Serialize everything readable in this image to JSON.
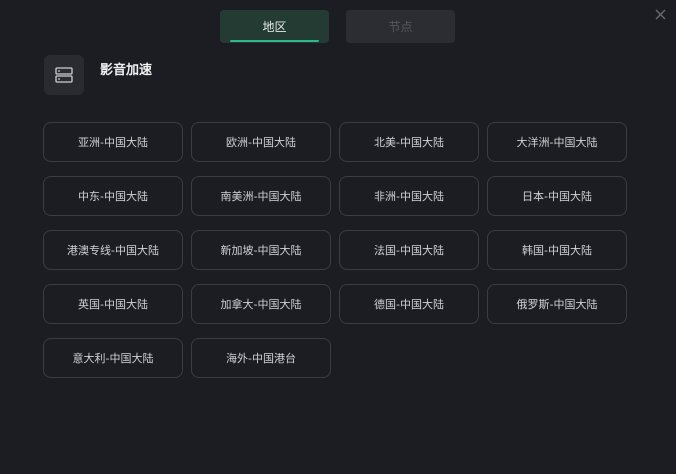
{
  "tabs": [
    {
      "label": "地区",
      "active": true
    },
    {
      "label": "节点",
      "active": false
    }
  ],
  "header": {
    "title": "影音加速",
    "icon": "server-icon"
  },
  "regions": [
    "亚洲-中国大陆",
    "欧洲-中国大陆",
    "北美-中国大陆",
    "大洋洲-中国大陆",
    "中东-中国大陆",
    "南美洲-中国大陆",
    "非洲-中国大陆",
    "日本-中国大陆",
    "港澳专线-中国大陆",
    "新加坡-中国大陆",
    "法国-中国大陆",
    "韩国-中国大陆",
    "英国-中国大陆",
    "加拿大-中国大陆",
    "德国-中国大陆",
    "俄罗斯-中国大陆",
    "意大利-中国大陆",
    "海外-中国港台"
  ],
  "colors": {
    "background": "#1c1d22",
    "accent": "#2fb889",
    "button_border": "#3b3d43"
  }
}
